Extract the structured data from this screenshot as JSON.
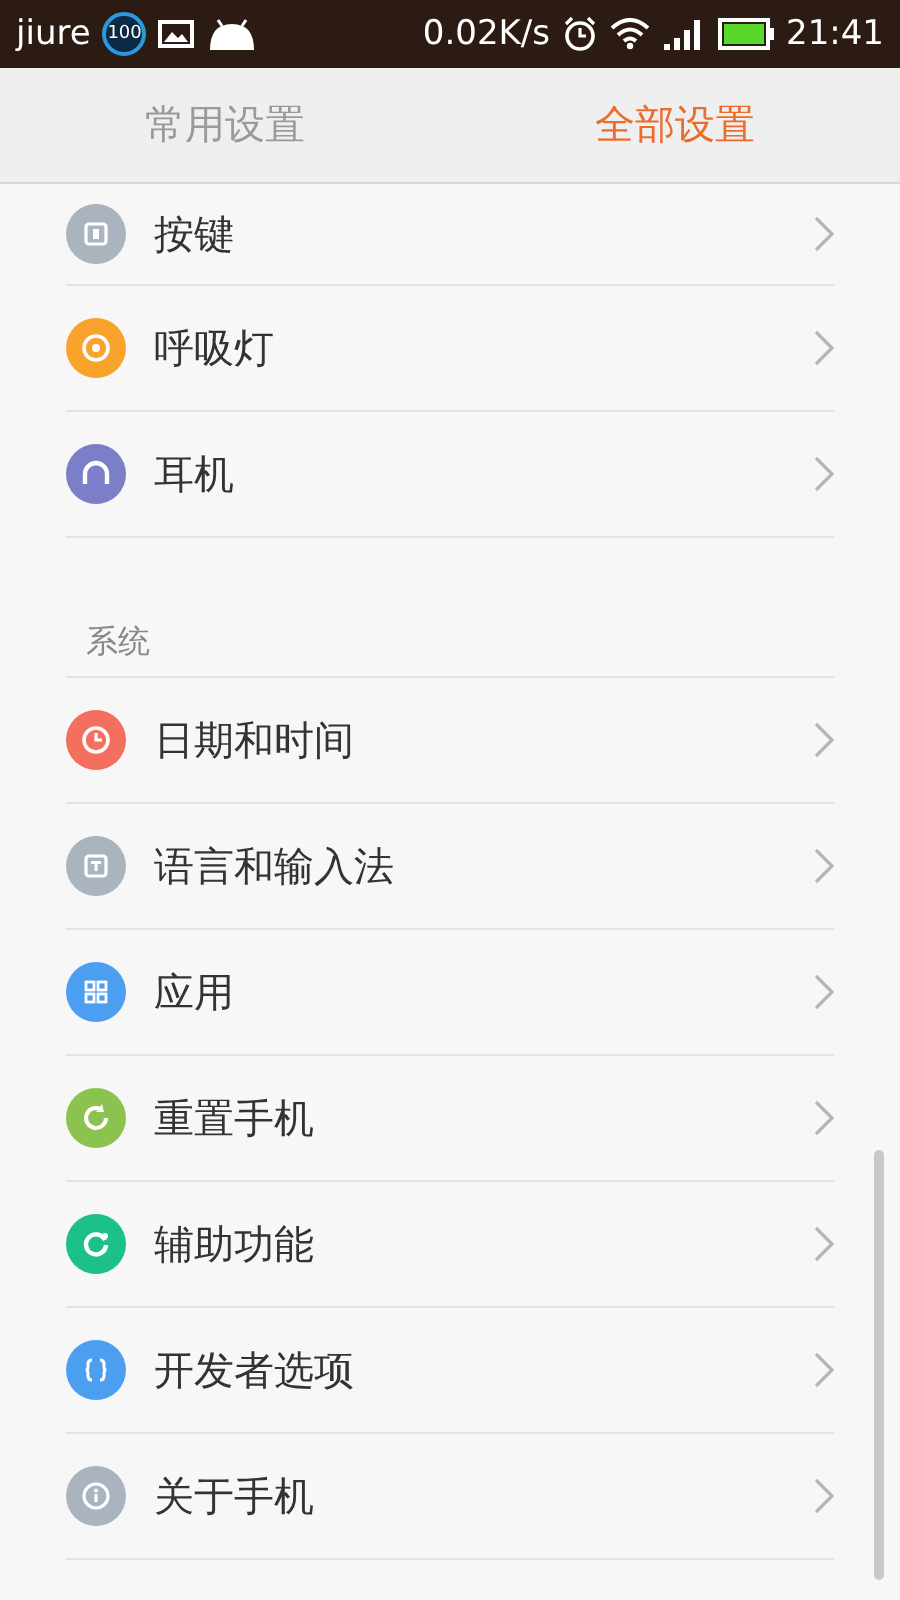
{
  "status_bar": {
    "carrier": "jiure",
    "badge": "100",
    "speed": "0.02K/s",
    "time": "21:41"
  },
  "tabs": [
    {
      "label": "常用设置",
      "selected": false
    },
    {
      "label": "全部设置",
      "selected": true
    }
  ],
  "sections": [
    {
      "items": [
        {
          "label": "按键",
          "color": "#aab4be"
        },
        {
          "label": "呼吸灯",
          "color": "#f8a42c"
        },
        {
          "label": "耳机",
          "color": "#7b7fc8"
        }
      ]
    },
    {
      "title": "系统",
      "items": [
        {
          "label": "日期和时间",
          "color": "#f36f5e"
        },
        {
          "label": "语言和输入法",
          "color": "#aab4be"
        },
        {
          "label": "应用",
          "color": "#4c9ff0"
        },
        {
          "label": "重置手机",
          "color": "#8cc250"
        },
        {
          "label": "辅助功能",
          "color": "#1dbf8a"
        },
        {
          "label": "开发者选项",
          "color": "#4c9ff0"
        },
        {
          "label": "关于手机",
          "color": "#aab4be"
        }
      ]
    }
  ]
}
